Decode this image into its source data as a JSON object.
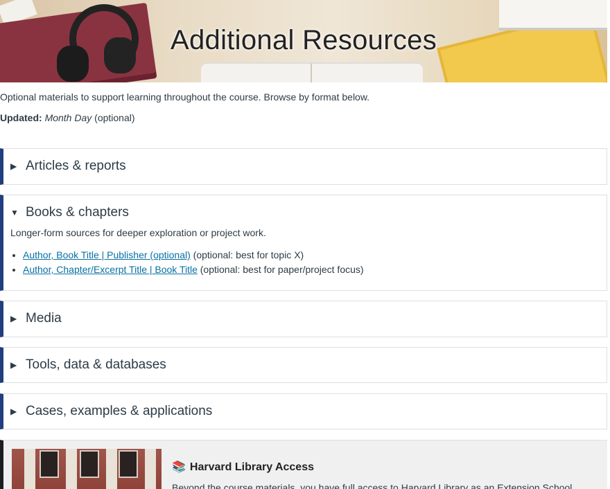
{
  "banner": {
    "title": "Additional Resources"
  },
  "intro": {
    "text": "Optional materials to support learning throughout the course. Browse by format below.",
    "updated_label": "Updated:",
    "updated_value": "Month Day",
    "updated_suffix": "(optional)"
  },
  "sections": [
    {
      "title": "Articles & reports",
      "expanded": false
    },
    {
      "title": "Books & chapters",
      "expanded": true,
      "description": "Longer-form sources for deeper exploration or project work.",
      "items": [
        {
          "link": "Author, Book Title | Publisher (optional)",
          "note": "(optional: best for topic X)"
        },
        {
          "link": "Author, Chapter/Excerpt Title | Book Title",
          "note": "(optional: best for paper/project focus)"
        }
      ]
    },
    {
      "title": "Media",
      "expanded": false
    },
    {
      "title": "Tools, data & databases",
      "expanded": false
    },
    {
      "title": "Cases, examples & applications",
      "expanded": false
    }
  ],
  "library": {
    "icon": "books-emoji",
    "title": "Harvard Library Access",
    "text": "Beyond the course materials, you have full access to Harvard Library as an Extension School"
  },
  "colors": {
    "accent": "#213f7f",
    "link": "#0770a3",
    "library_bar": "#1e1e1e"
  }
}
